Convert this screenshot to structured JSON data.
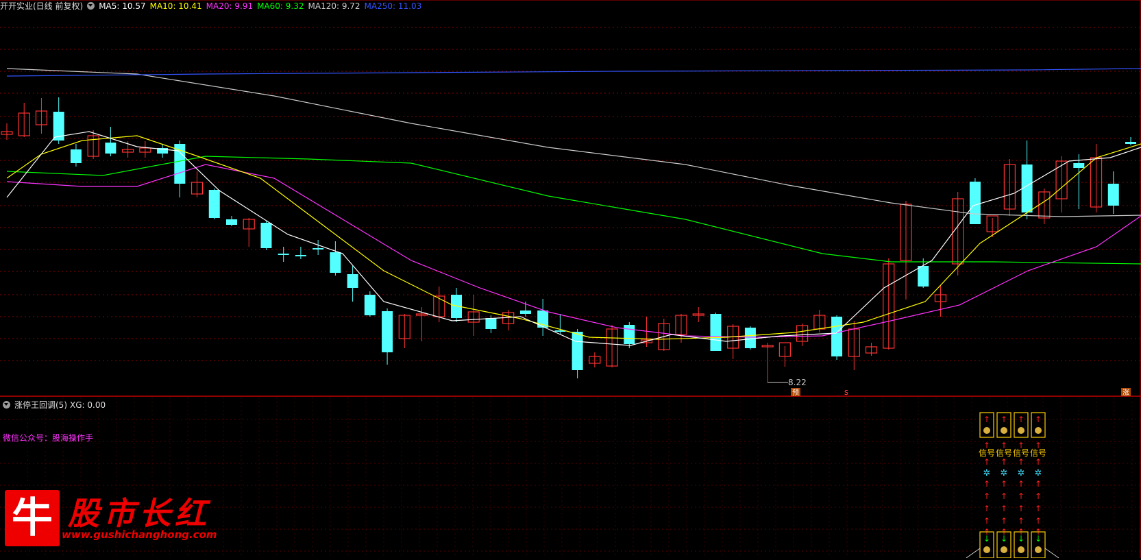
{
  "header": {
    "stock_title": "开开实业(日线 前复权)",
    "ma": [
      {
        "label": "MA5: 10.57",
        "color": "#ffffff"
      },
      {
        "label": "MA10: 10.41",
        "color": "#ffff00"
      },
      {
        "label": "MA20: 9.91",
        "color": "#ff33ff"
      },
      {
        "label": "MA60: 9.32",
        "color": "#00ff00"
      },
      {
        "label": "MA120: 9.72",
        "color": "#cccccc"
      },
      {
        "label": "MA250: 11.03",
        "color": "#3355ff"
      }
    ]
  },
  "indicator": {
    "title": "涨停王回调(5)",
    "xg": "XG: 0.00",
    "wechat": "微信公众号：股海操作手",
    "signal_label": "信号"
  },
  "annotations": {
    "low_price": "8.22",
    "marker_yu": "预",
    "marker_s": "s",
    "marker_zhang": "涨"
  },
  "logo": {
    "char": "牛",
    "title": "股市长红",
    "url": "www.gushichanghong.com"
  },
  "colors": {
    "up": "#ff3333",
    "down": "#54ffff",
    "grid": "#8b0000",
    "ma5": "#ffffff",
    "ma10": "#ffff00",
    "ma20": "#ff33ff",
    "ma60": "#00ff00",
    "ma120": "#cccccc",
    "ma250": "#3355ff"
  }
}
